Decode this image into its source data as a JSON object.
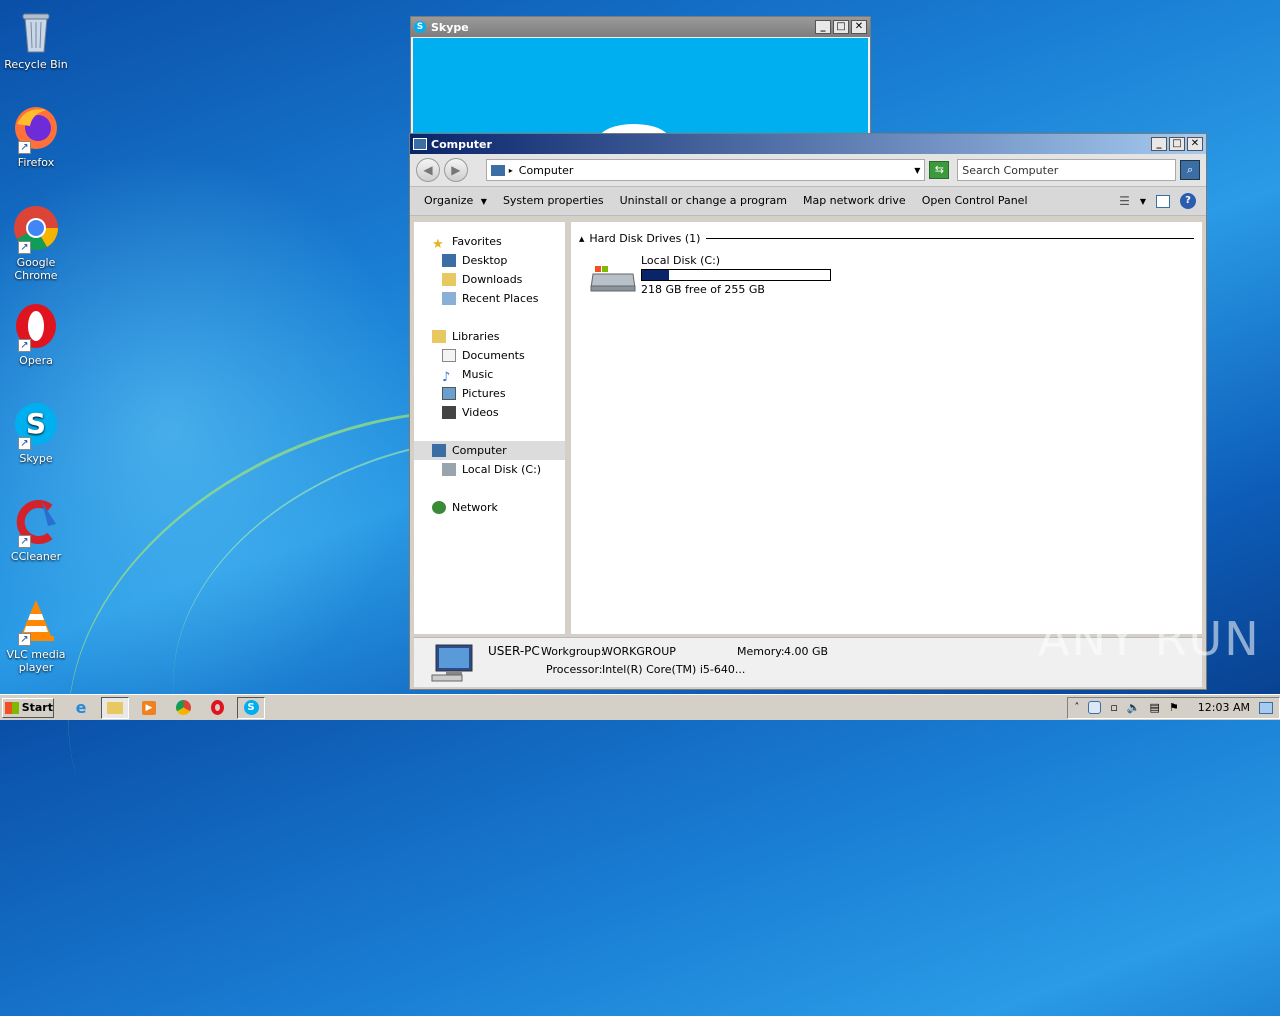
{
  "desktop": {
    "icons": [
      {
        "label": "Recycle Bin"
      },
      {
        "label": "Firefox"
      },
      {
        "label": "Google Chrome"
      },
      {
        "label": "Opera"
      },
      {
        "label": "Skype"
      },
      {
        "label": "CCleaner"
      },
      {
        "label": "VLC media player"
      }
    ],
    "watermark": "ANY RUN"
  },
  "skype_window": {
    "title": "Skype",
    "accent": "#00aff0"
  },
  "explorer": {
    "title": "Computer",
    "address": "Computer",
    "search_placeholder": "Search Computer",
    "commands": [
      "Organize",
      "System properties",
      "Uninstall or change a program",
      "Map network drive",
      "Open Control Panel"
    ],
    "nav": {
      "favorites": "Favorites",
      "favorites_items": [
        "Desktop",
        "Downloads",
        "Recent Places"
      ],
      "libraries": "Libraries",
      "libraries_items": [
        "Documents",
        "Music",
        "Pictures",
        "Videos"
      ],
      "computer": "Computer",
      "computer_items": [
        "Local Disk (C:)"
      ],
      "network": "Network"
    },
    "group_header": "Hard Disk Drives (1)",
    "drive": {
      "name": "Local Disk (C:)",
      "free_text": "218 GB free of 255 GB",
      "used_fraction": 0.145
    },
    "details": {
      "pc_name": "USER-PC",
      "workgroup_label": "Workgroup:",
      "workgroup": "WORKGROUP",
      "memory_label": "Memory:",
      "memory": "4.00 GB",
      "processor_label": "Processor:",
      "processor": "Intel(R) Core(TM) i5-640..."
    }
  },
  "taskbar": {
    "start_label": "Start",
    "clock": "12:03 AM"
  }
}
